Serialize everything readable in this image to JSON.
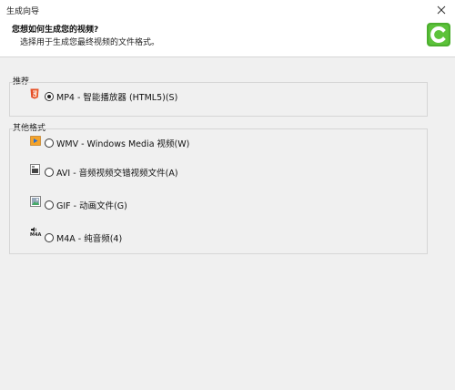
{
  "window": {
    "title": "生成向导",
    "close_icon": "close-icon"
  },
  "header": {
    "title": "您想如何生成您的视频?",
    "subtitle": "选择用于生成您最终视频的文件格式。",
    "logo_icon": "camtasia-logo-icon",
    "logo_color": "#4caf2e"
  },
  "recommended": {
    "label": "推荐",
    "options": [
      {
        "label": "MP4 - 智能播放器 (HTML5)(S)",
        "icon": "html5-icon",
        "selected": true
      }
    ]
  },
  "other_formats": {
    "label": "其他格式",
    "options": [
      {
        "label": "WMV - Windows Media 视频(W)",
        "icon": "windows-media-icon",
        "selected": false
      },
      {
        "label": "AVI - 音频视频交错视频文件(A)",
        "icon": "film-icon",
        "selected": false
      },
      {
        "label": "GIF - 动画文件(G)",
        "icon": "gif-image-icon",
        "selected": false
      },
      {
        "label": "M4A - 纯音频(4)",
        "icon": "m4a-audio-icon",
        "icon_text": "M4A",
        "selected": false
      }
    ]
  }
}
